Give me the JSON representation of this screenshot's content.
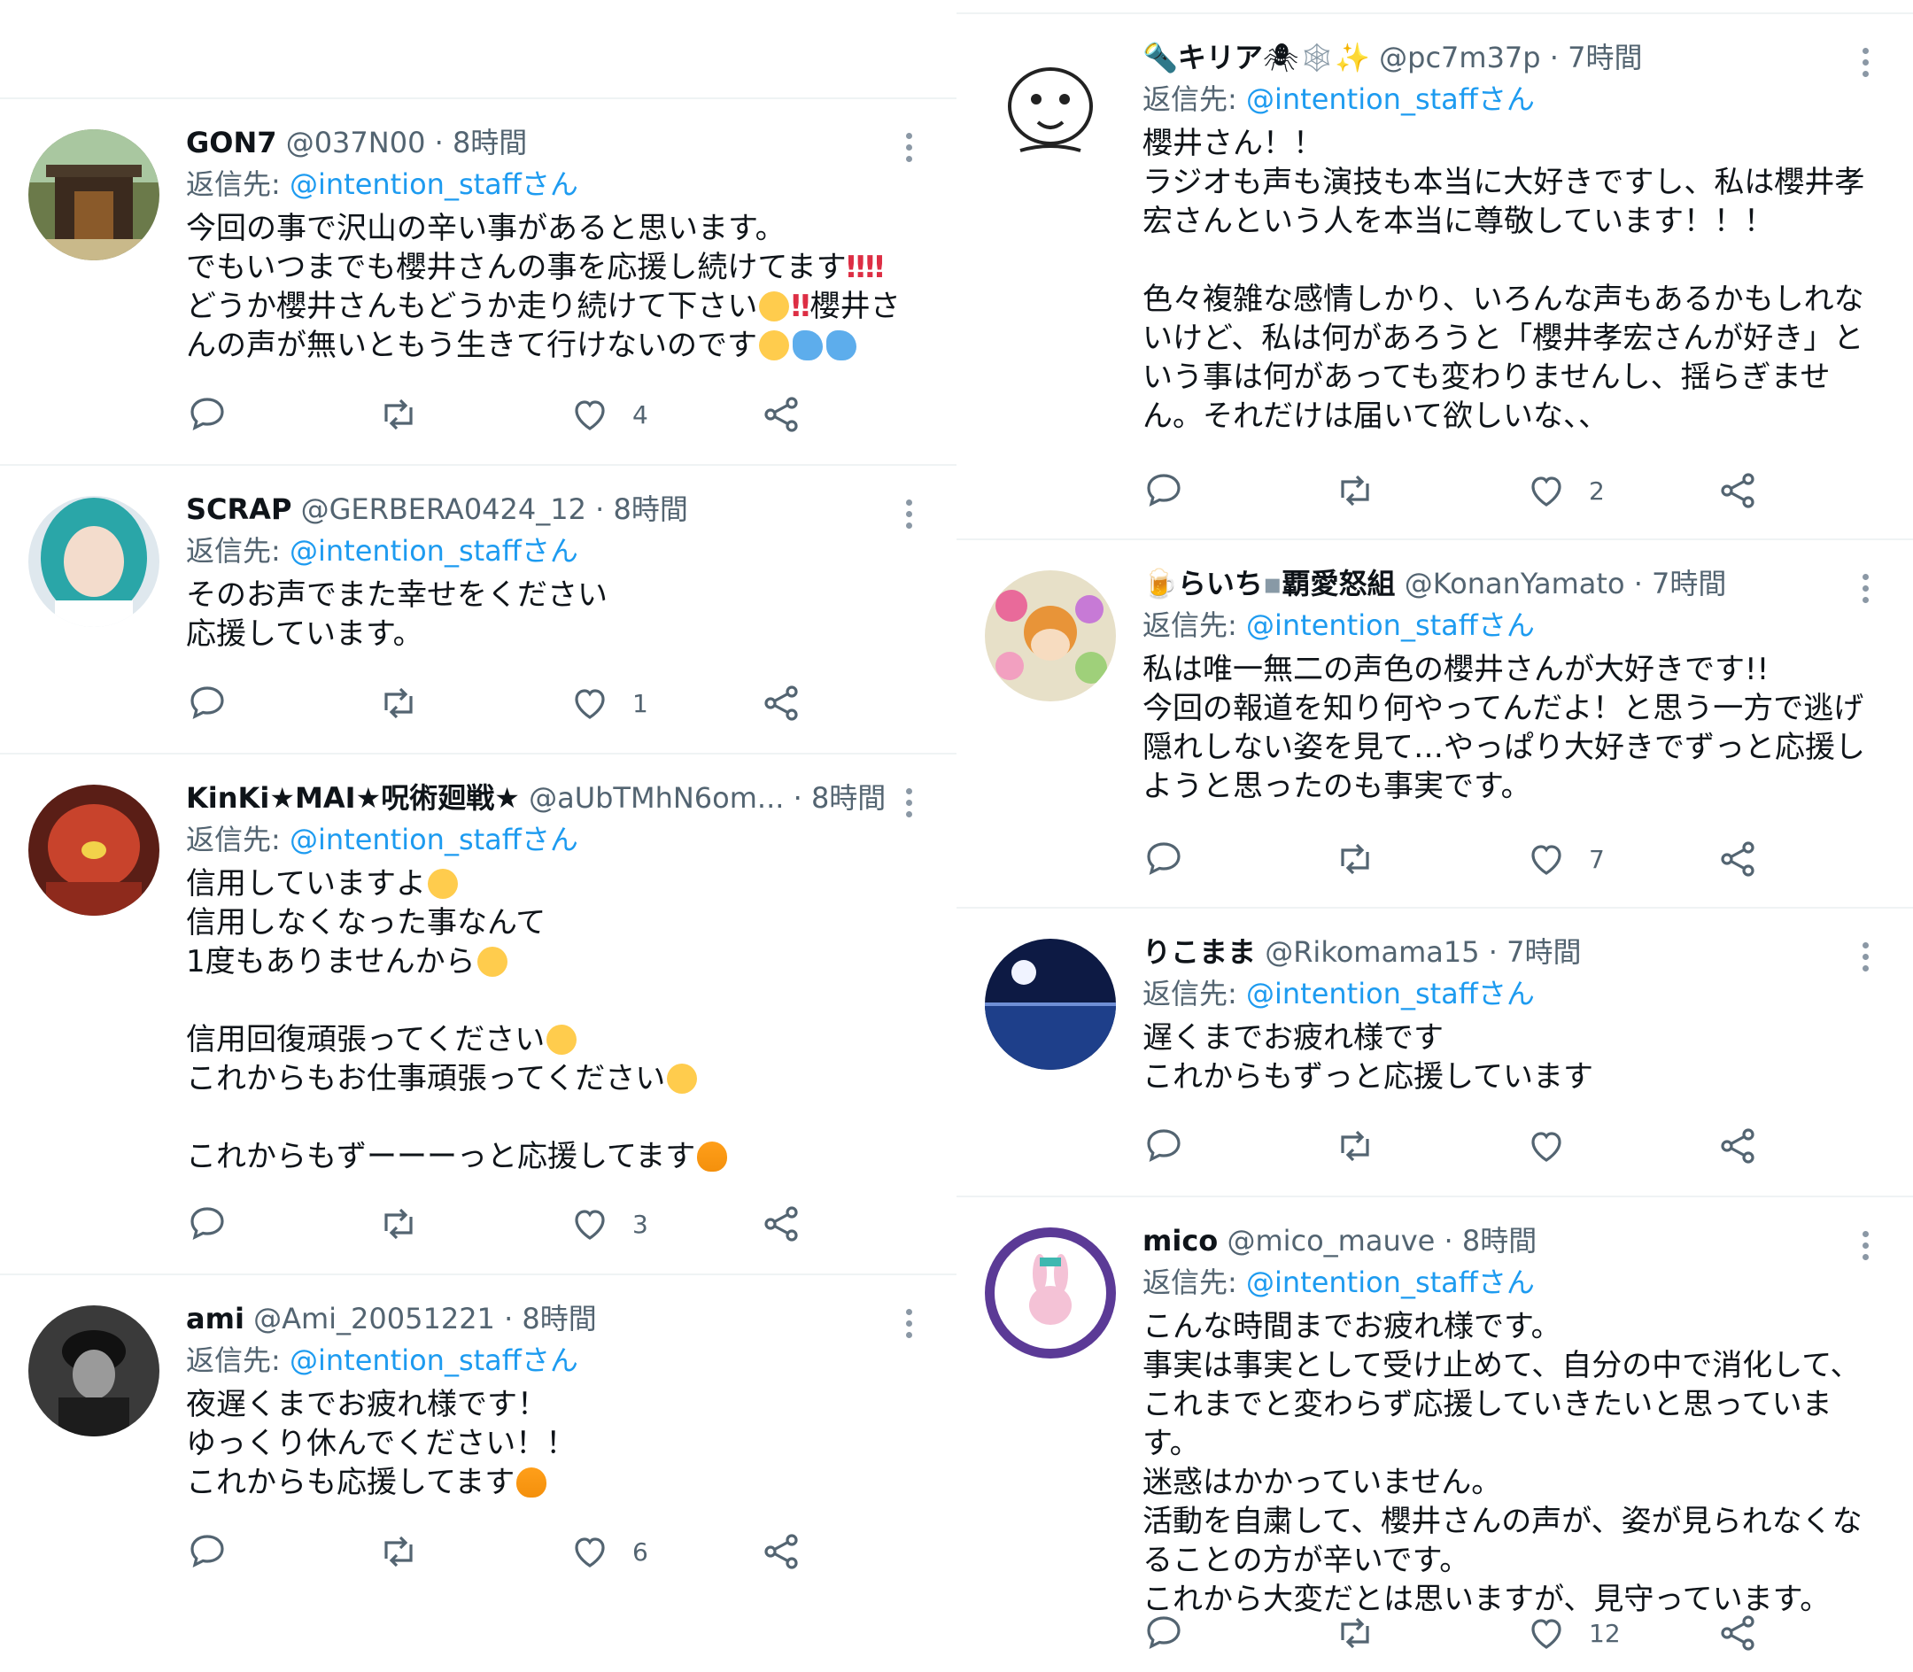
{
  "icons": {
    "reply": "reply-icon",
    "retweet": "retweet-icon",
    "like": "heart-icon",
    "share": "share-icon",
    "more": "more-vertical-icon"
  },
  "colors": {
    "mention": "#1d9bf0",
    "secondary_text": "#536471",
    "divider": "#eff3f4"
  },
  "left_column": [
    {
      "display_name": "GON7",
      "handle": "@037N00",
      "time": "8時間",
      "reply_prefix": "返信先: ",
      "reply_to": "@intention_staffさん",
      "text_parts": [
        "今回の事で沢山の辛い事があると思います。\nでもいつまでも櫻井さんの事を応援し続けてます",
        "\nどうか櫻井さんもどうか走り続けて下さい",
        "櫻井さんの声が無いともう生きて行けないのです"
      ],
      "like_count": "4"
    },
    {
      "display_name": "SCRAP",
      "handle": "@GERBERA0424_12",
      "time": "8時間",
      "reply_prefix": "返信先: ",
      "reply_to": "@intention_staffさん",
      "text": "そのお声でまた幸せをください\n応援しています。",
      "like_count": "1"
    },
    {
      "display_name": "KinKi★MAI★呪術廻戦★",
      "handle": "@aUbTMhN6om...",
      "time": "8時間",
      "reply_prefix": "返信先: ",
      "reply_to": "@intention_staffさん",
      "text_parts": [
        "信用していますよ",
        "\n信用しなくなった事なんて\n1度もありませんから",
        "\n\n信用回復頑張ってください",
        "\nこれからもお仕事頑張ってください",
        "\n\nこれからもずーーーっと応援してます"
      ],
      "like_count": "3"
    },
    {
      "display_name": "ami",
      "handle": "@Ami_20051221",
      "time": "8時間",
      "reply_prefix": "返信先: ",
      "reply_to": "@intention_staffさん",
      "text_parts": [
        "夜遅くまでお疲れ様です！\nゆっくり休んでください！！\nこれからも応援してます"
      ],
      "like_count": "6"
    }
  ],
  "right_column": [
    {
      "display_name": "キリア",
      "handle": "@pc7m37p",
      "time": "7時間",
      "reply_prefix": "返信先: ",
      "reply_to": "@intention_staffさん",
      "text": "櫻井さん！！\nラジオも声も演技も本当に大好きですし、私は櫻井孝宏さんという人を本当に尊敬しています！！！\n\n色々複雑な感情しかり、いろんな声もあるかもしれないけど、私は何があろうと「櫻井孝宏さんが好き」という事は何があっても変わりませんし、揺らぎません。それだけは届いて欲しいな、、",
      "like_count": "2"
    },
    {
      "display_name": "らいち",
      "display_name_suffix": "覇愛怒組",
      "handle": "@KonanYamato",
      "time": "7時間",
      "reply_prefix": "返信先: ",
      "reply_to": "@intention_staffさん",
      "text": "私は唯一無二の声色の櫻井さんが大好きです!!\n今回の報道を知り何やってんだよ！と思う一方で逃げ隠れしない姿を見て…やっぱり大好きでずっと応援しようと思ったのも事実です。",
      "like_count": "7"
    },
    {
      "display_name": "りこまま",
      "handle": "@Rikomama15",
      "time": "7時間",
      "reply_prefix": "返信先: ",
      "reply_to": "@intention_staffさん",
      "text": "遅くまでお疲れ様です\nこれからもずっと応援しています",
      "like_count": ""
    },
    {
      "display_name": "mico",
      "handle": "@mico_mauve",
      "time": "8時間",
      "reply_prefix": "返信先: ",
      "reply_to": "@intention_staffさん",
      "text": "こんな時間までお疲れ様です。\n事実は事実として受け止めて、自分の中で消化して、これまでと変わらず応援していきたいと思っています。\n迷惑はかかっていません。\n活動を自粛して、櫻井さんの声が、姿が見られなくなることの方が辛いです。\nこれから大変だとは思いますが、見守っています。",
      "like_count": "12"
    }
  ]
}
